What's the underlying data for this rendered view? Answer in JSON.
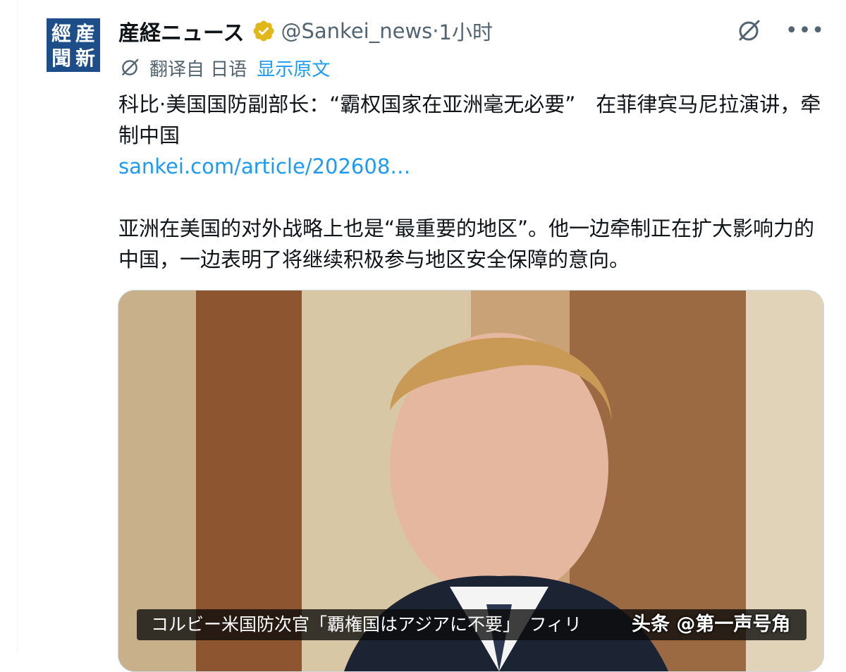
{
  "account": {
    "avatar_chars": [
      "産",
      "經",
      "新",
      "聞"
    ],
    "display_name": "産経ニュース",
    "handle": "@Sankei_news",
    "separator": " · ",
    "time": "1小时"
  },
  "icons": {
    "verified": "verified-badge-icon",
    "grok": "grok-icon",
    "more": "more-icon",
    "translate": "translate-icon"
  },
  "translation": {
    "label": "翻译自 日语",
    "show_original": "显示原文"
  },
  "tweet": {
    "headline": "科比·美国国防副部长：“霸权国家在亚洲毫无必要”　在菲律宾马尼拉演讲，牵制中国",
    "link": "sankei.com/article/202608…",
    "body": "亚洲在美国的对外战略上也是“最重要的地区”。他一边牵制正在扩大影响力的中国，一边表明了将继续积极参与地区安全保障的意向。"
  },
  "media": {
    "caption": "コルビー米国防次官「覇権国はアジアに不要」　フィリ",
    "watermark": "头条 @第一声号角"
  },
  "colors": {
    "link": "#1d9bf0",
    "secondary_text": "#536471",
    "verified_badge": "#e2b719",
    "avatar_bg": "#1d4e89"
  }
}
